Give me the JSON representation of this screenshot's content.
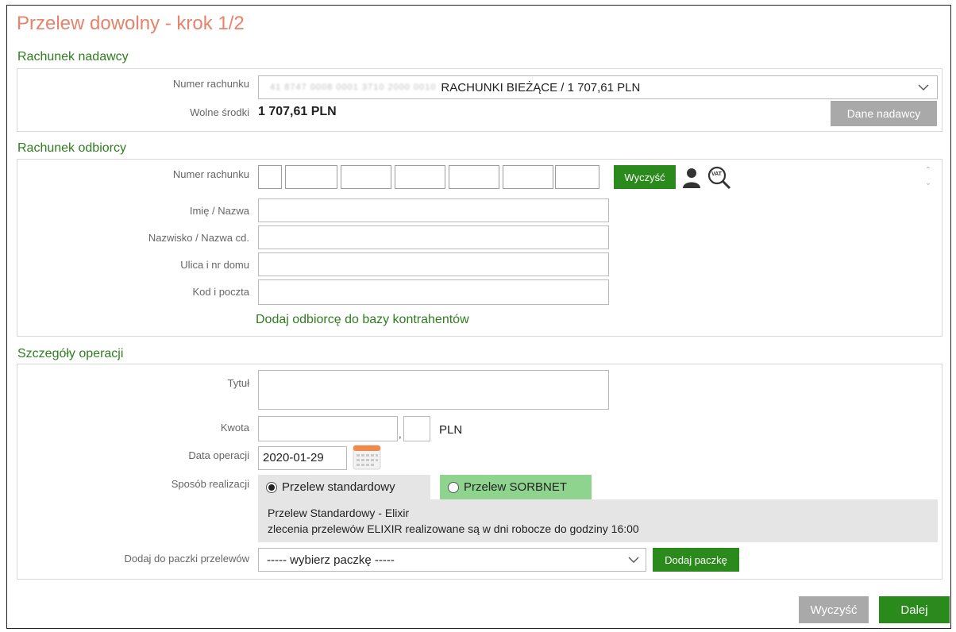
{
  "page": {
    "title": "Przelew dowolny - krok 1/2"
  },
  "sender": {
    "section_title": "Rachunek nadawcy",
    "account_label": "Numer rachunku",
    "account_masked": "41 8747 0008 0001 3710 2000 0010",
    "account_text": "RACHUNKI BIEŻĄCE / 1 707,61 PLN",
    "funds_label": "Wolne środki",
    "funds_value": "1 707,61 PLN",
    "sender_data_button": "Dane nadawcy"
  },
  "recipient": {
    "section_title": "Rachunek odbiorcy",
    "account_label": "Numer rachunku",
    "clear_button": "Wyczyść",
    "contact_icon": "person-icon",
    "vat_icon": "vat-search-icon",
    "vat_text": "VAT",
    "name_label": "Imię / Nazwa",
    "surname_label": "Nazwisko / Nazwa cd.",
    "street_label": "Ulica i nr domu",
    "postal_label": "Kod i poczta",
    "add_contractor_link": "Dodaj odbiorcę do bazy kontrahentów"
  },
  "details": {
    "section_title": "Szczegóły operacji",
    "title_label": "Tytuł",
    "amount_label": "Kwota",
    "amount_sep": ",",
    "currency": "PLN",
    "date_label": "Data operacji",
    "date_value": "2020-01-29",
    "method_label": "Sposób realizacji",
    "method_standard": "Przelew standardowy",
    "method_sorbnet": "Przelew SORBNET",
    "info_line1": "Przelew Standardowy - Elixir",
    "info_line2": "zlecenia przelewów ELIXIR realizowane są w dni robocze do godziny 16:00",
    "package_label": "Dodaj do paczki przelewów",
    "package_value": "----- wybierz paczkę -----",
    "add_package_button": "Dodaj paczkę"
  },
  "footer": {
    "clear_button": "Wyczyść",
    "next_button": "Dalej"
  },
  "colors": {
    "title": "#e8826a",
    "section": "#2e7d1e",
    "green_button": "#2b8a1c",
    "sorbnet_tab": "#8ed38e",
    "gray_button": "#a9a9a9"
  }
}
